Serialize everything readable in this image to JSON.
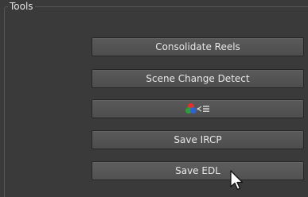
{
  "panel": {
    "title": "Tools"
  },
  "buttons": {
    "consolidate_label": "Consolidate Reels",
    "scene_change_label": "Scene Change Detect",
    "colour_icon": "rgb-circles-list-icon",
    "save_ircp_label": "Save IRCP",
    "save_edl_label": "Save EDL"
  },
  "colors": {
    "background": "#3a3a3a",
    "button": "#525252",
    "text": "#e6e6e6"
  }
}
